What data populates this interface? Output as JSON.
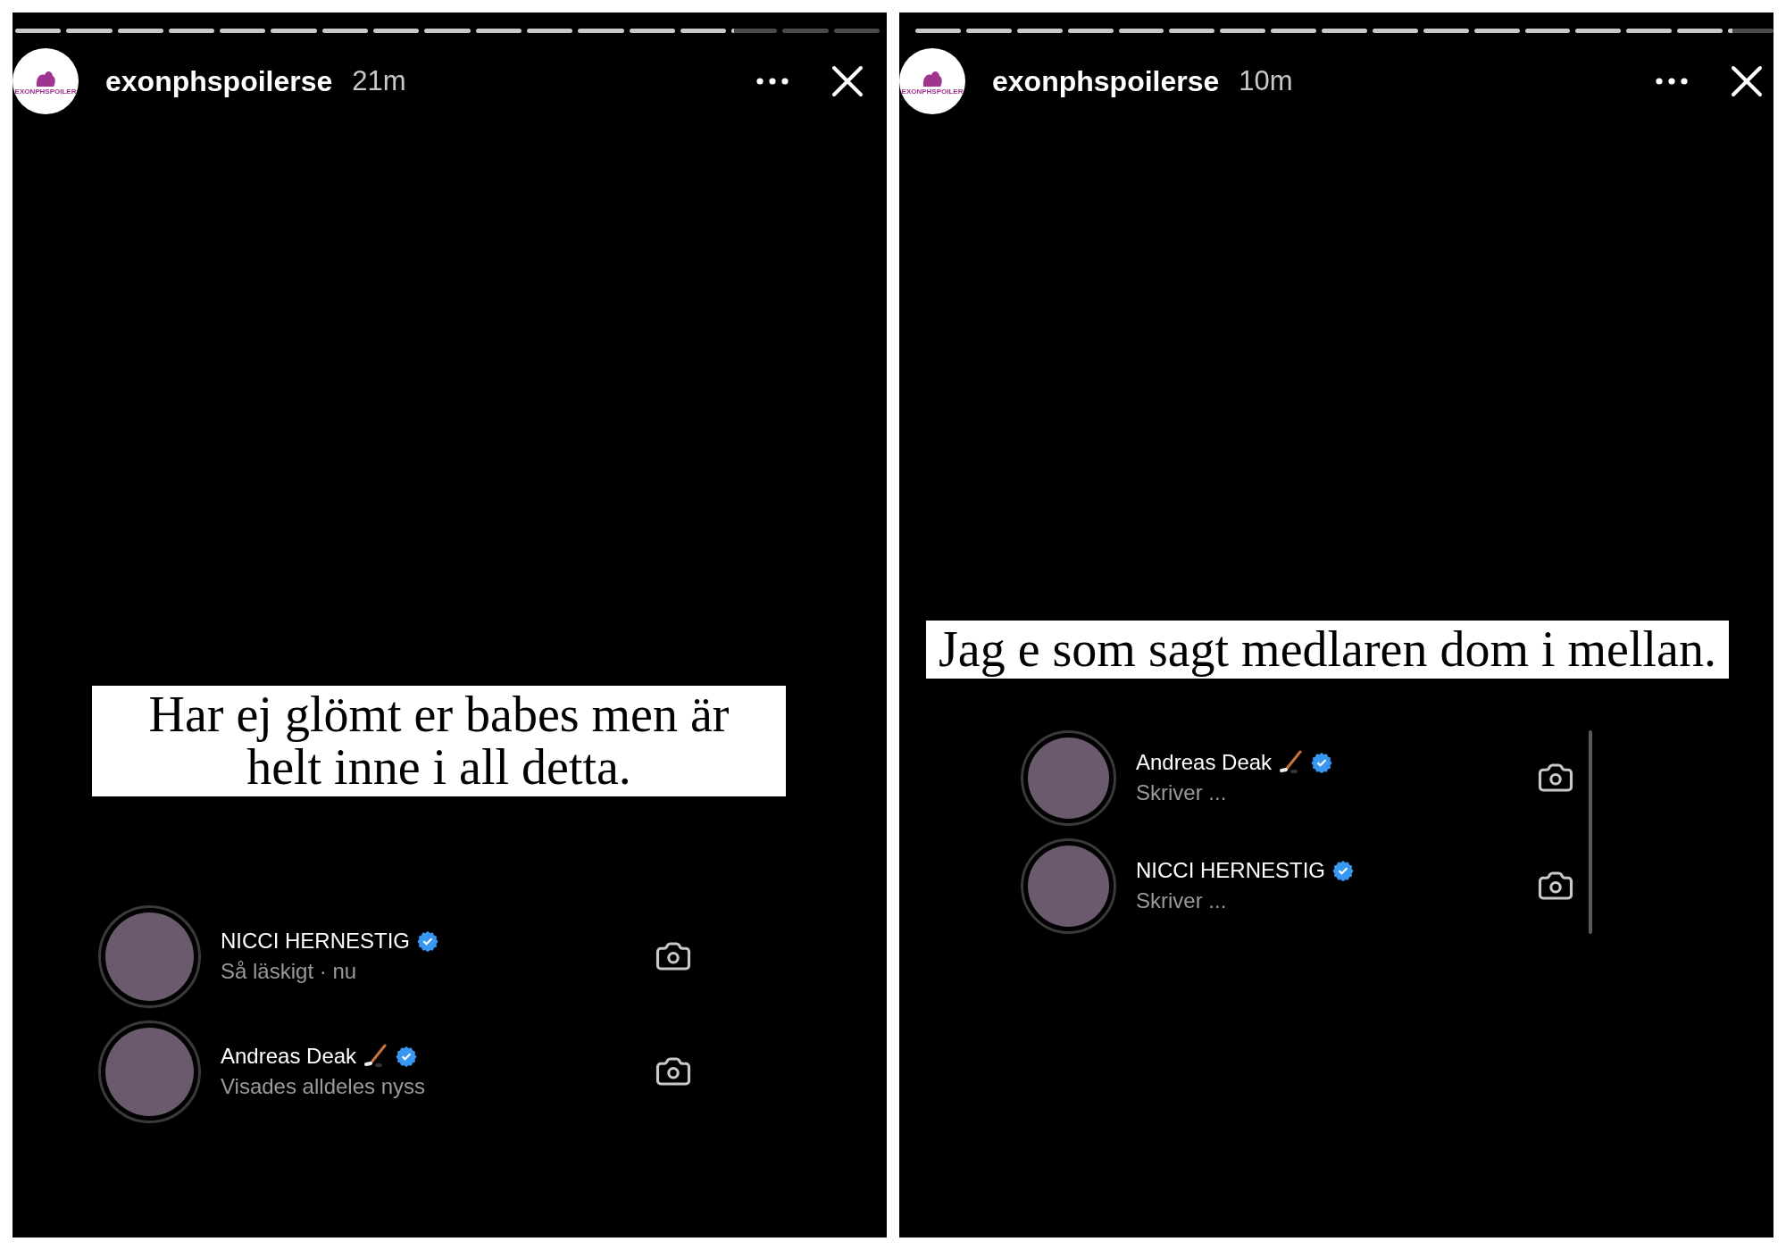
{
  "stories": [
    {
      "progress": [
        {
          "level": 1
        },
        {
          "level": 1
        },
        {
          "level": 1
        },
        {
          "level": 1
        },
        {
          "level": 1
        },
        {
          "level": 1
        },
        {
          "level": 1
        },
        {
          "level": 1
        },
        {
          "level": 1
        },
        {
          "level": 1
        },
        {
          "level": 1
        },
        {
          "level": 1
        },
        {
          "level": 1
        },
        {
          "level": 1
        },
        {
          "level": 0.05
        },
        {
          "level": 0
        },
        {
          "level": 0
        }
      ],
      "account": {
        "logo_text": "EXONPHSPOILER",
        "username": "exonphspoilerse",
        "time": "21m"
      },
      "caption": "Har ej glömt er babes men är helt inne i all detta.",
      "scrollbar": false,
      "viewers": [
        {
          "name": "NICCI HERNESTIG",
          "hockey_stick": false,
          "verified": true,
          "status": "Så läskigt · nu"
        },
        {
          "name": "Andreas Deak",
          "hockey_stick": true,
          "verified": true,
          "status": "Visades alldeles nyss"
        }
      ]
    },
    {
      "progress": [
        {
          "level": 1
        },
        {
          "level": 1
        },
        {
          "level": 1
        },
        {
          "level": 1
        },
        {
          "level": 1
        },
        {
          "level": 1
        },
        {
          "level": 1
        },
        {
          "level": 1
        },
        {
          "level": 1
        },
        {
          "level": 1
        },
        {
          "level": 1
        },
        {
          "level": 1
        },
        {
          "level": 1
        },
        {
          "level": 1
        },
        {
          "level": 1
        },
        {
          "level": 1
        },
        {
          "level": 0.1
        }
      ],
      "account": {
        "logo_text": "EXONPHSPOILER",
        "username": "exonphspoilerse",
        "time": "10m"
      },
      "caption": "Jag e som sagt medlaren dom i mellan.",
      "scrollbar": true,
      "viewers": [
        {
          "name": "Andreas Deak",
          "hockey_stick": true,
          "verified": true,
          "status": "Skriver ..."
        },
        {
          "name": "NICCI HERNESTIG",
          "hockey_stick": false,
          "verified": true,
          "status": "Skriver ..."
        }
      ]
    }
  ]
}
